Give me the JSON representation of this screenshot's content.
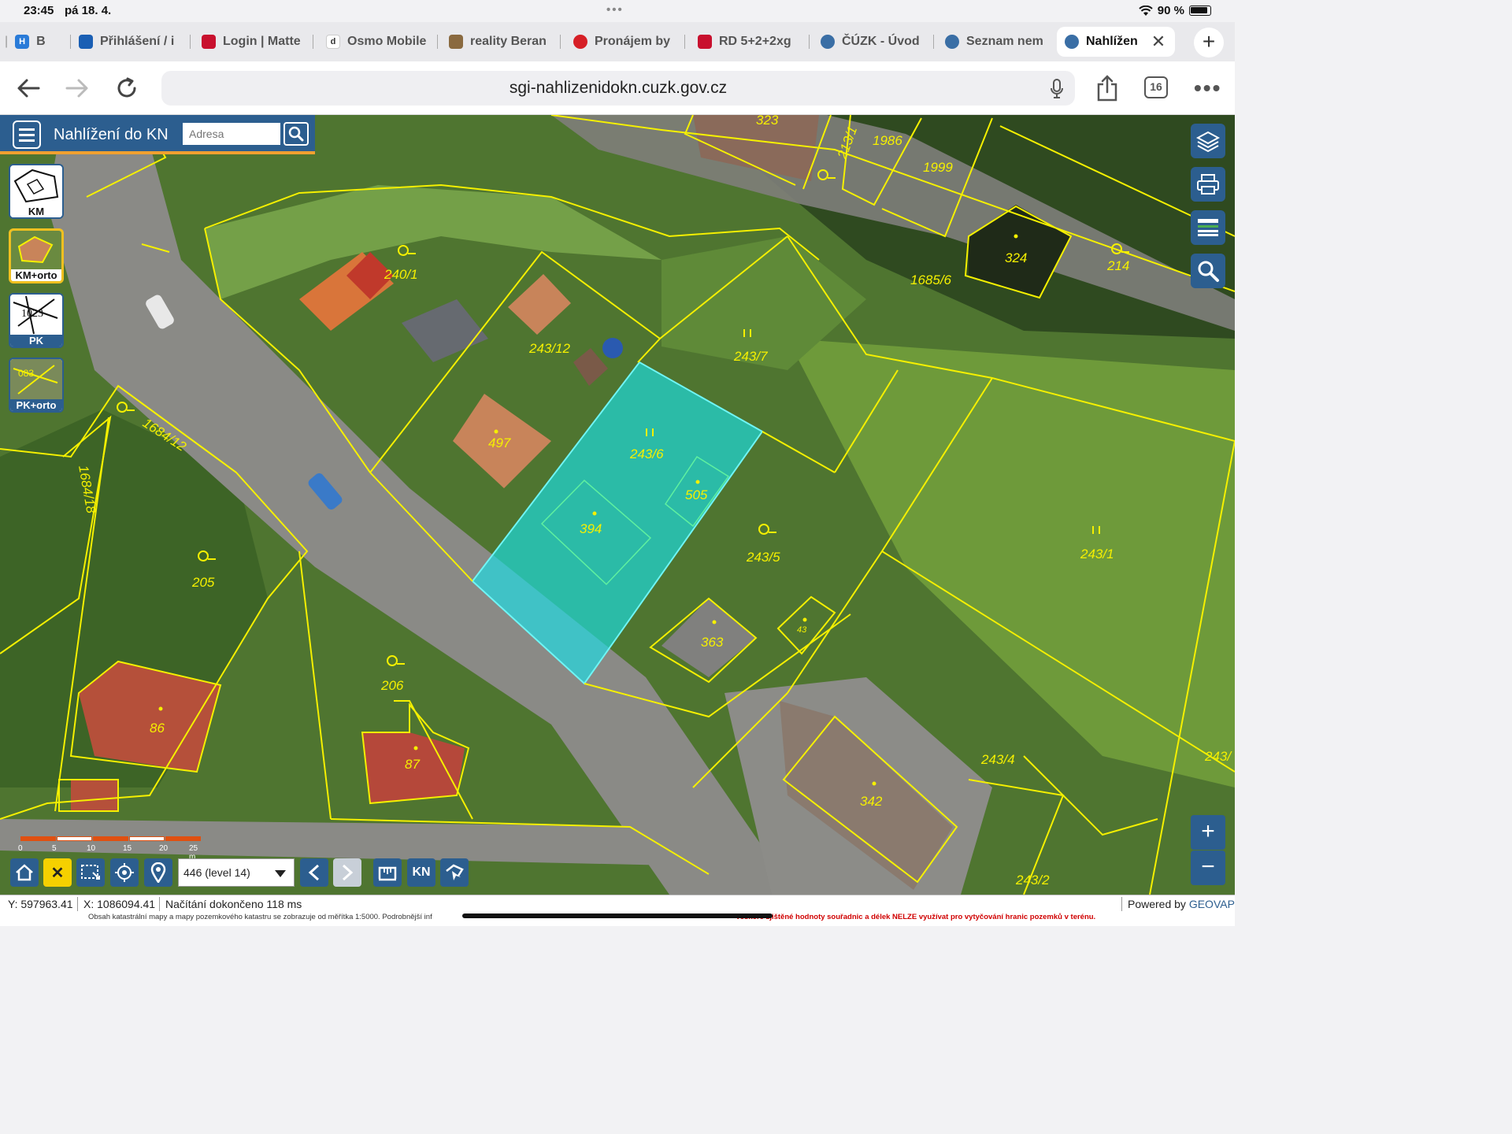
{
  "status": {
    "time": "23:45",
    "date": "pá 18. 4.",
    "battery": "90 %"
  },
  "tabs": [
    {
      "label": "B",
      "fav_color": "#2a7bd8",
      "fav_text": "Ⓗ"
    },
    {
      "label": "Přihlášení / i",
      "fav_color": "#1a5fb4",
      "fav_text": "■"
    },
    {
      "label": "Login | Matte",
      "fav_color": "#c8102e",
      "fav_text": "■"
    },
    {
      "label": "Osmo Mobile",
      "fav_color": "#333333",
      "fav_text": "◆"
    },
    {
      "label": "reality Beran",
      "fav_color": "#8a6a40",
      "fav_text": "▪"
    },
    {
      "label": "Pronájem by",
      "fav_color": "#d61f26",
      "fav_text": "●"
    },
    {
      "label": "RD 5+2+2xg",
      "fav_color": "#c8102e",
      "fav_text": "■"
    },
    {
      "label": "ČÚZK - Úvod",
      "fav_color": "#3a6ea5",
      "fav_text": "◎"
    },
    {
      "label": "Seznam nem",
      "fav_color": "#3a6ea5",
      "fav_text": "◎"
    },
    {
      "label": "Nahlížen",
      "fav_color": "#3a6ea5",
      "fav_text": "◎"
    }
  ],
  "url": "sgi-nahlizenidokn.cuzk.gov.cz",
  "tab_count": "16",
  "app": {
    "title": "Nahlížení do KN",
    "search_placeholder": "Adresa",
    "layers": [
      {
        "label": "KM"
      },
      {
        "label": "KM+orto"
      },
      {
        "label": "PK"
      },
      {
        "label": "PK+orto"
      }
    ],
    "scale_value": "446 (level 14)",
    "scale_ticks": [
      "0",
      "5",
      "10",
      "15",
      "20",
      "25 m"
    ],
    "kn_label": "KN"
  },
  "parcels": [
    {
      "label": "323"
    },
    {
      "label": "213/1"
    },
    {
      "label": "1986"
    },
    {
      "label": "1999"
    },
    {
      "label": "324"
    },
    {
      "label": "214"
    },
    {
      "label": "1685/6"
    },
    {
      "label": "240/1"
    },
    {
      "label": "243/12"
    },
    {
      "label": "243/7"
    },
    {
      "label": "497"
    },
    {
      "label": "243/6"
    },
    {
      "label": "505"
    },
    {
      "label": "394"
    },
    {
      "label": "1684/12"
    },
    {
      "label": "1684/18"
    },
    {
      "label": "205"
    },
    {
      "label": "243/5"
    },
    {
      "label": "243/1"
    },
    {
      "label": "363"
    },
    {
      "label": "43"
    },
    {
      "label": "206"
    },
    {
      "label": "86"
    },
    {
      "label": "87"
    },
    {
      "label": "243/4"
    },
    {
      "label": "342"
    },
    {
      "label": "243/2"
    },
    {
      "label": "243/"
    }
  ],
  "footer": {
    "y_coord": "Y: 597963.41",
    "x_coord": "X: 1086094.41",
    "status": "Načítání dokončeno 118 ms",
    "powered": "Powered by",
    "powered_brand": "GEOVAP",
    "note": "Obsah katastrální mapy a mapy pozemkového katastru se zobrazuje od měřítka 1:5000. Podrobnější inf",
    "note_warn": "Veškeré zjištěné hodnoty souřadnic a délek NELZE využívat pro vytyčování hranic pozemků v terénu."
  },
  "colors": {
    "accent": "#2c5e8f",
    "parcel_line": "#f5f000",
    "highlight": "#19e0e8",
    "orange_bar": "#f0a030"
  }
}
